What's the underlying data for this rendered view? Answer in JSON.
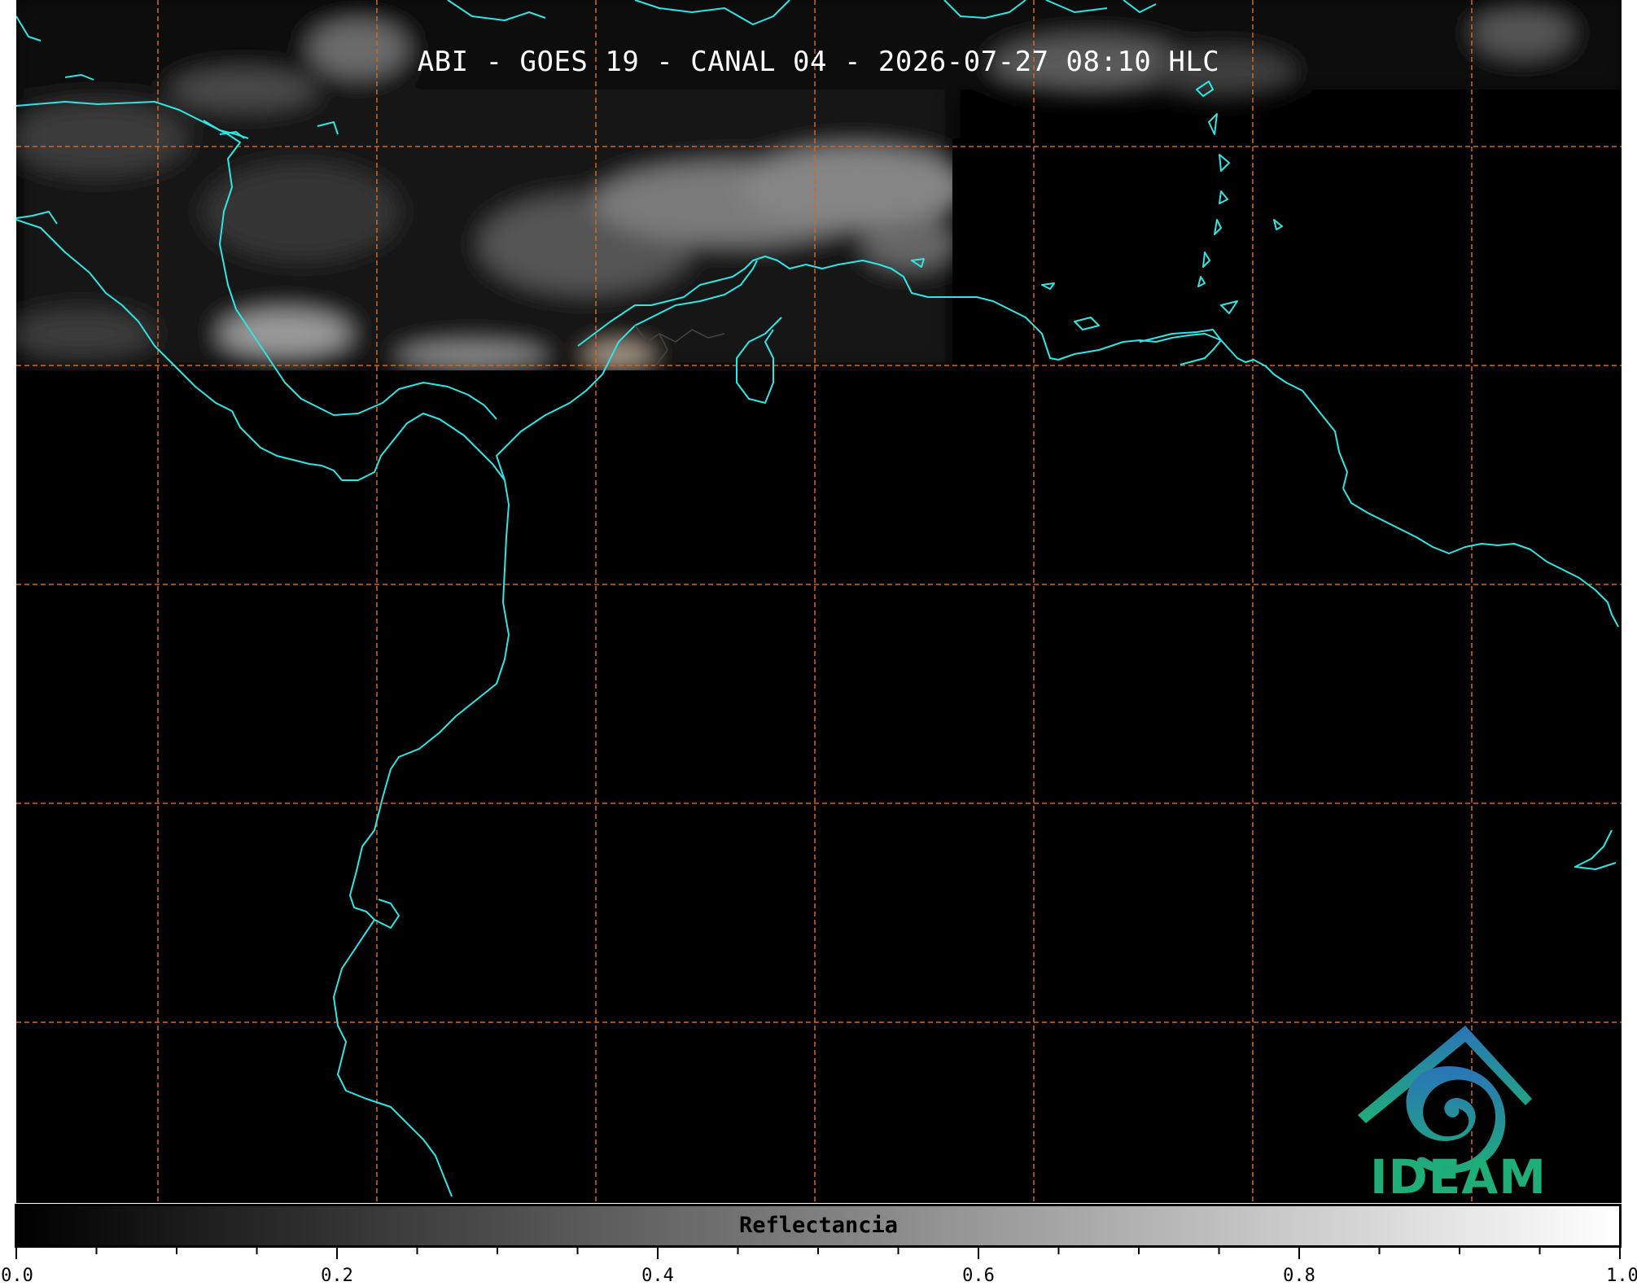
{
  "title": "ABI - GOES 19 - CANAL 04 - 2026-07-27 08:10 HLC",
  "colors": {
    "coastline": "#2ee6e6",
    "grid": "#d2691e",
    "background": "#000000",
    "logo_green": "#1fae78",
    "logo_blue": "#2a74b8"
  },
  "colorbar": {
    "label": "Reflectancia",
    "min": 0.0,
    "max": 1.0,
    "tick_labels": [
      "0.0",
      "0.2",
      "0.4",
      "0.6",
      "0.8",
      "1.0"
    ],
    "minor_tick_step": 0.05,
    "colormap": "greys"
  },
  "map": {
    "gridlines": "dashed",
    "icons": [
      "ideam-logo"
    ]
  },
  "logo": {
    "text": "IDEAM"
  }
}
